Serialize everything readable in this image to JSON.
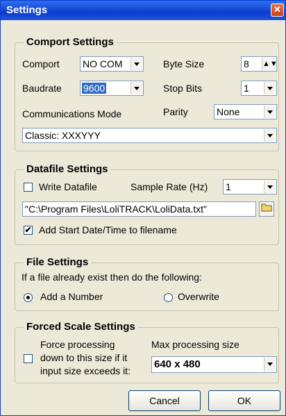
{
  "window": {
    "title": "Settings",
    "close_icon": "✕"
  },
  "comport": {
    "legend": "Comport Settings",
    "comport_label": "Comport",
    "comport_value": "NO COM",
    "byte_size_label": "Byte Size",
    "byte_size_value": "8",
    "baudrate_label": "Baudrate",
    "baudrate_value": "9600",
    "stop_bits_label": "Stop Bits",
    "stop_bits_value": "1",
    "mode_label": "Communications Mode",
    "parity_label": "Parity",
    "parity_value": "None",
    "mode_value": "Classic:  XXXYYY"
  },
  "datafile": {
    "legend": "Datafile Settings",
    "write_label": "Write Datafile",
    "write_checked": false,
    "sample_rate_label": "Sample Rate (Hz)",
    "sample_rate_value": "1",
    "path_value": "\"C:\\Program Files\\LoliTRACK\\LoliData.txt\"",
    "add_date_label": "Add Start Date/Time to filename",
    "add_date_checked": true,
    "check_mark": "✔"
  },
  "file": {
    "legend": "File Settings",
    "instruction": "If a file already exist then do the following:",
    "option_add": "Add a Number",
    "option_overwrite": "Overwrite",
    "selected": "add"
  },
  "forced": {
    "legend": "Forced Scale Settings",
    "force_label_line1": "Force processing",
    "force_label_line2": "down to this size if it",
    "force_label_line3": "input size exceeds it:",
    "force_checked": false,
    "max_size_label": "Max processing size",
    "max_size_value": "640 x 480"
  },
  "buttons": {
    "cancel": "Cancel",
    "ok": "OK"
  },
  "icons": {
    "folder": "folder-icon",
    "spin": "spin-arrows-icon",
    "dropdown": "chevron-down-icon",
    "close": "close-icon"
  }
}
